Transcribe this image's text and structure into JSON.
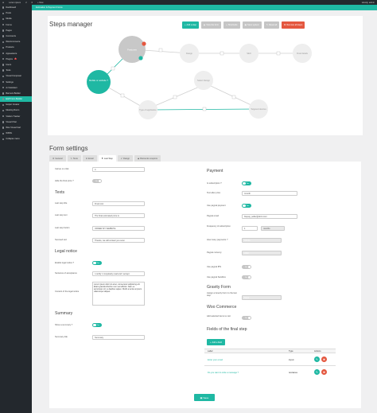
{
  "adminbar": {
    "site": "Lorem ipsum",
    "updates": "2",
    "comments": "0",
    "new": "+ New",
    "user": "Howdy, admin"
  },
  "sidebar": {
    "items": [
      {
        "label": "Dashboard"
      },
      {
        "label": "Posts"
      },
      {
        "label": "Media"
      },
      {
        "label": "Forms"
      },
      {
        "label": "Pages"
      },
      {
        "label": "Comments"
      },
      {
        "label": "WooCommerce"
      },
      {
        "label": "Products"
      },
      {
        "label": "Appearance"
      },
      {
        "label": "Plugins",
        "badge": "2"
      },
      {
        "label": "Users"
      },
      {
        "label": "Tools"
      },
      {
        "label": "Visual Composer"
      },
      {
        "label": "Settings"
      },
      {
        "label": "AJ Assistant"
      },
      {
        "label": "Banners Builder"
      },
      {
        "label": "E&P Form Builder",
        "active": true
      },
      {
        "label": "Helper Creator"
      },
      {
        "label": "Meeting Room"
      },
      {
        "label": "Visitors Tracker"
      },
      {
        "label": "Visual Chat"
      },
      {
        "label": "Woo Visual Cart"
      },
      {
        "label": "WPML"
      },
      {
        "label": "Collapse menu"
      }
    ]
  },
  "pagebar": {
    "title": "Estimation & Payment Forms"
  },
  "steps": {
    "title": "Steps manager",
    "toolbar": [
      "Add a step",
      "View the form",
      "Shortcode",
      "Save system",
      "Reset all",
      "Remove all steps"
    ],
    "nodes": [
      {
        "label": "Features",
        "id": "n1"
      },
      {
        "label": "Design",
        "id": "n2"
      },
      {
        "label": "SEO",
        "id": "n3"
      },
      {
        "label": "Final details",
        "id": "n4"
      },
      {
        "label": "Mobile or website ?",
        "id": "n5"
      },
      {
        "label": "Select Design",
        "id": "n6"
      },
      {
        "label": "Type of application",
        "id": "n7"
      },
      {
        "label": "Targeted devices",
        "id": "n8"
      }
    ]
  },
  "form_settings": {
    "title": "Form settings",
    "tabs": [
      "General",
      "Texts",
      "Email",
      "Last Step",
      "Design",
      "Discounts coupons"
    ],
    "active_tab": "Last Step",
    "left": {
      "call_next_step_label": "Call an on click",
      "call_next_step_value": "4",
      "hide_final_price_label": "Hide the final price ?",
      "hide_final_price": "No",
      "texts_heading": "Texts",
      "last_step_title_label": "Last step title",
      "last_step_title": "Final cost",
      "last_step_text_label": "Last step text",
      "last_step_text": "The final estimated price is",
      "last_step_button_label": "Last step button",
      "last_step_button": "ORDER MY WEBSITE",
      "success_text_label": "Succeed text",
      "success_text": "Thanks, we will contact you soon",
      "legal_heading": "Legal notice",
      "enable_legal_label": "Enable legal notice ?",
      "enable_legal": "Yes",
      "sentence_label": "Sentence of acceptance",
      "sentence": "I certify I completely read and I accept",
      "content_legal_label": "Content of the legal notice",
      "content_legal": "Lorem ipsum dolor sit amet, consectetur adipiscing elit. Etiam gravida lobortis nunc sed efficitur. Nam eu accumsan orci, a dapibus sapien. Morbi a lectus a ipsum ullamcorper aliquet.",
      "summary_heading": "Summary",
      "show_summary_label": "Show a summary ?",
      "show_summary": "Yes",
      "summary_title_label": "Summary title",
      "summary_title": "Summary"
    },
    "right": {
      "payment_heading": "Payment",
      "is_subscription_label": "Is subscription ?",
      "is_subscription": "Yes",
      "text_after_price_label": "Text after price",
      "text_after_price": "/month",
      "use_paypal_label": "Use paypal payment",
      "use_paypal": "Yes",
      "paypal_email_label": "Paypal email",
      "paypal_email": "biopup_seller@dont.com",
      "frequency_label": "Frequency of subscription",
      "frequency_value": "1",
      "frequency_unit": "months",
      "how_many_label": "How many payments ?",
      "how_many": "Infinite",
      "currency_label": "Paypal currency",
      "currency": "USD",
      "paypal_ipn_label": "Use paypal IPN",
      "paypal_ipn": "No",
      "sandbox_label": "Use paypal Sandbox",
      "sandbox": "No",
      "gravity_heading": "Gravity Form",
      "assign_gravity_label": "Assign a Gravity Form to the last step",
      "assign_gravity": "None",
      "woo_heading": "Woo Commerce",
      "add_cart_label": "Add selected items to cart",
      "add_cart": "No",
      "fields_heading": "Fields of the final step",
      "add_field": "Add a field",
      "table_headers": [
        "Label",
        "Type",
        "Actions"
      ],
      "rows": [
        {
          "label": "Enter your email",
          "type": "input"
        },
        {
          "label": "Do you want to write a message ?",
          "type": "textarea"
        }
      ]
    },
    "save": "Save"
  },
  "colors": {
    "accent": "#1fb8a3",
    "danger": "#e4573f",
    "admin": "#23282d"
  }
}
